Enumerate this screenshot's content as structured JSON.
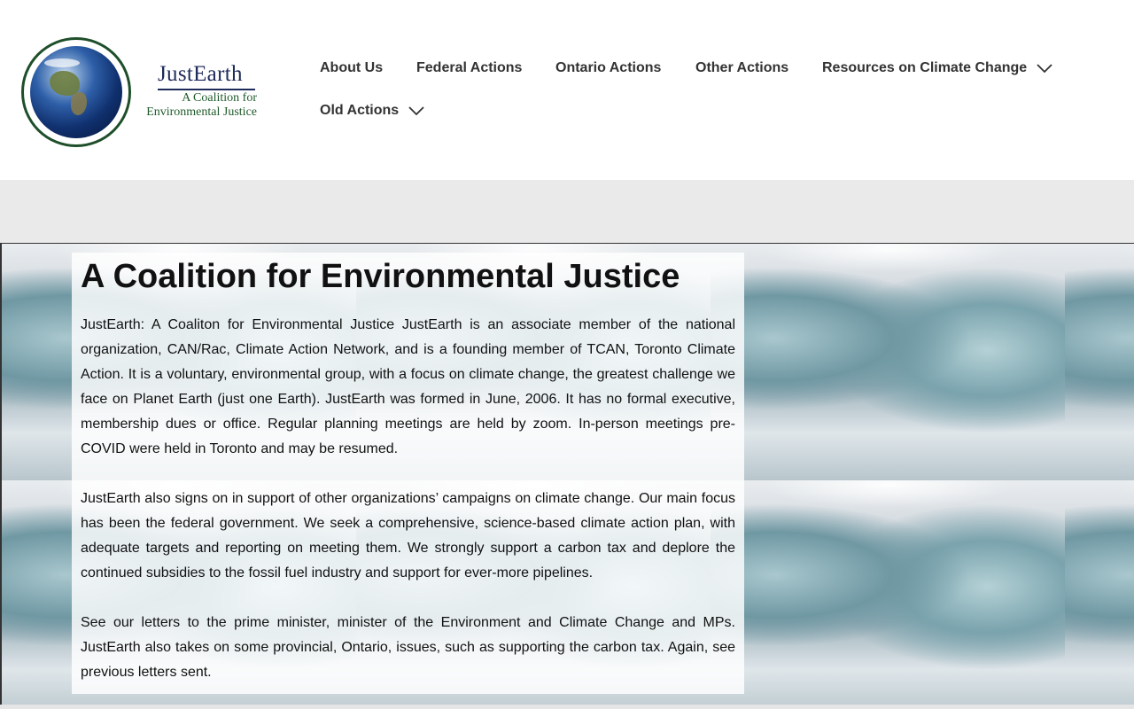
{
  "logo": {
    "name": "JustEarth",
    "tagline_line1": "A Coalition for",
    "tagline_line2": "Environmental Justice"
  },
  "nav": {
    "items": [
      {
        "label": "About Us",
        "has_dropdown": false
      },
      {
        "label": "Federal Actions",
        "has_dropdown": false
      },
      {
        "label": "Ontario Actions",
        "has_dropdown": false
      },
      {
        "label": "Other Actions",
        "has_dropdown": false
      },
      {
        "label": "Resources on Climate Change",
        "has_dropdown": true,
        "icon": "chevron-down-icon"
      },
      {
        "label": "Old Actions",
        "has_dropdown": true,
        "icon": "chevron-down-icon"
      }
    ]
  },
  "hero": {
    "title": "A Coalition for Environmental Justice",
    "paragraphs": [
      "JustEarth: A Coaliton for Environmental Justice JustEarth is an associate member of the national organization, CAN/Rac, Climate Action Network, and is a founding member of TCAN, Toronto Climate Action. It is a voluntary, environmental group, with a focus on climate change, the greatest challenge we face on Planet Earth (just one Earth). JustEarth was formed in June, 2006. It has no formal executive, membership dues or office. Regular planning meetings are held by zoom. In-person meetings pre-COVID were held in Toronto and may be resumed.",
      "JustEarth also signs on in support of other organizations’ campaigns on climate change.  Our main focus has been the federal government. We seek a comprehensive, science-based climate action plan, with adequate targets and reporting on meeting them. We strongly support a carbon tax and deplore the continued subsidies to the fossil fuel industry and support for ever-more pipelines.",
      "See our letters to the prime minister, minister of the Environment and Climate Change and MPs.  JustEarth also takes on some provincial, Ontario, issues, such as supporting the carbon tax. Again, see previous letters sent."
    ]
  },
  "colors": {
    "nav_text": "#333333",
    "band": "#eaeaea",
    "logo_green": "#1f5a2a",
    "logo_navy": "#1d2a5a"
  }
}
